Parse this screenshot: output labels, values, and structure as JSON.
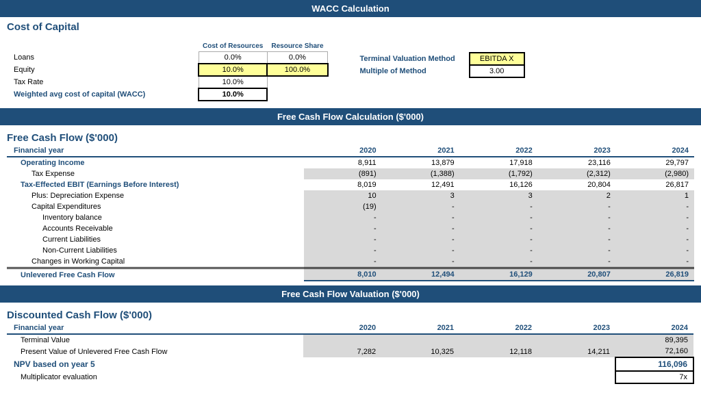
{
  "wacc_header": "WACC Calculation",
  "cost_of_capital": {
    "title": "Cost of Capital",
    "col_headers": [
      "Cost of Resources",
      "Resource Share"
    ],
    "rows": [
      {
        "label": "Loans",
        "cost": "0.0%",
        "share": "0.0%",
        "label_bold": false
      },
      {
        "label": "Equity",
        "cost": "10.0%",
        "share": "100.0%",
        "label_bold": false
      },
      {
        "label": "Tax Rate",
        "cost": "10.0%",
        "share": "",
        "label_bold": false
      },
      {
        "label": "Weighted avg cost of capital (WACC)",
        "cost": "10.0%",
        "share": "",
        "label_bold": true
      }
    ],
    "terminal_valuation_label": "Terminal Valuation Method",
    "terminal_valuation_value": "EBITDA X",
    "multiple_of_method_label": "Multiple of Method",
    "multiple_of_method_value": "3.00"
  },
  "fcf_header": "Free Cash Flow Calculation ($'000)",
  "fcf_section": {
    "title": "Free Cash Flow ($'000)",
    "years": [
      "2020",
      "2021",
      "2022",
      "2023",
      "2024"
    ],
    "rows": [
      {
        "label": "Financial year",
        "indent": 0,
        "bold": true,
        "is_header": true,
        "values": [
          "2020",
          "2021",
          "2022",
          "2023",
          "2024"
        ]
      },
      {
        "label": "Operating Income",
        "indent": 1,
        "bold": true,
        "values": [
          "8,911",
          "13,879",
          "17,918",
          "23,116",
          "29,797"
        ],
        "bg": "white"
      },
      {
        "label": "Tax Expense",
        "indent": 2,
        "bold": false,
        "values": [
          "(891)",
          "(1,388)",
          "(1,792)",
          "(2,312)",
          "(2,980)"
        ],
        "bg": "gray"
      },
      {
        "label": "Tax-Effected EBIT (Earnings Before Interest)",
        "indent": 1,
        "bold": true,
        "values": [
          "8,019",
          "12,491",
          "16,126",
          "20,804",
          "26,817"
        ],
        "bg": "white"
      },
      {
        "label": "Plus: Depreciation Expense",
        "indent": 2,
        "bold": false,
        "values": [
          "10",
          "3",
          "3",
          "2",
          "1"
        ],
        "bg": "gray"
      },
      {
        "label": "Capital Expenditures",
        "indent": 2,
        "bold": false,
        "values": [
          "(19)",
          "-",
          "-",
          "-",
          "-"
        ],
        "bg": "gray"
      },
      {
        "label": "Inventory balance",
        "indent": 3,
        "bold": false,
        "values": [
          "-",
          "-",
          "-",
          "-",
          "-"
        ],
        "bg": "gray"
      },
      {
        "label": "Accounts Receivable",
        "indent": 3,
        "bold": false,
        "values": [
          "-",
          "-",
          "-",
          "-",
          "-"
        ],
        "bg": "gray"
      },
      {
        "label": "Current Liabilities",
        "indent": 3,
        "bold": false,
        "values": [
          "-",
          "-",
          "-",
          "-",
          "-"
        ],
        "bg": "gray"
      },
      {
        "label": "Non-Current Liabilities",
        "indent": 3,
        "bold": false,
        "values": [
          "-",
          "-",
          "-",
          "-",
          "-"
        ],
        "bg": "gray"
      },
      {
        "label": "Changes in Working Capital",
        "indent": 2,
        "bold": false,
        "values": [
          "-",
          "-",
          "-",
          "-",
          "-"
        ],
        "bg": "gray"
      },
      {
        "label": "Unlevered Free Cash Flow",
        "indent": 1,
        "bold": true,
        "values": [
          "8,010",
          "12,494",
          "16,129",
          "20,807",
          "26,819"
        ],
        "bg": "bold",
        "unlevered": true
      }
    ]
  },
  "valuation_header": "Free Cash Flow Valuation ($'000)",
  "dcf_section": {
    "title": "Discounted Cash Flow ($'000)",
    "rows": [
      {
        "label": "Financial year",
        "indent": 0,
        "bold": true,
        "is_header": true,
        "values": [
          "2020",
          "2021",
          "2022",
          "2023",
          "2024"
        ]
      },
      {
        "label": "Terminal Value",
        "indent": 1,
        "bold": false,
        "values": [
          "",
          "",
          "",
          "",
          "89,395"
        ],
        "bg": "gray"
      },
      {
        "label": "Present Value of Unlevered Free Cash Flow",
        "indent": 1,
        "bold": false,
        "values": [
          "7,282",
          "10,325",
          "12,118",
          "14,211",
          "72,160"
        ],
        "bg": "gray"
      },
      {
        "label": "NPV based on year 5",
        "indent": 0,
        "bold": true,
        "is_npv": true,
        "values": [
          "",
          "",
          "",
          "",
          "116,096"
        ]
      },
      {
        "label": "Multiplicator evaluation",
        "indent": 1,
        "bold": false,
        "is_mult": true,
        "values": [
          "",
          "",
          "",
          "",
          "7x"
        ]
      }
    ]
  }
}
